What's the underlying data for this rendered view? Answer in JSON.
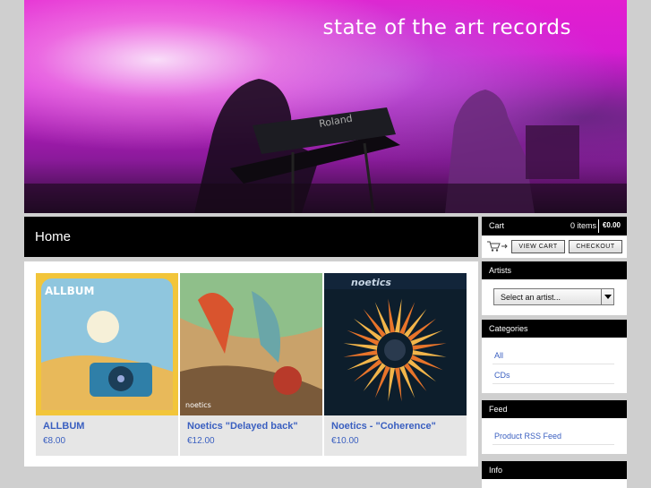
{
  "banner": {
    "title": "state of the art records"
  },
  "page": {
    "heading": "Home"
  },
  "products": [
    {
      "name": "ALLBUM",
      "price": "€8.00",
      "art_text": "ALLBUM"
    },
    {
      "name": "Noetics \"Delayed back\"",
      "price": "€12.00",
      "art_text": "noetics"
    },
    {
      "name": "Noetics - \"Coherence\"",
      "price": "€10.00",
      "art_text": "noetics"
    }
  ],
  "cart": {
    "label": "Cart",
    "items": "0 items",
    "total": "€0.00",
    "view_label": "VIEW CART",
    "checkout_label": "CHECKOUT"
  },
  "artists": {
    "label": "Artists",
    "select_value": "Select an artist..."
  },
  "categories": {
    "label": "Categories",
    "items": [
      "All",
      "CDs"
    ]
  },
  "feed": {
    "label": "Feed",
    "link": "Product RSS Feed"
  },
  "info": {
    "label": "Info"
  }
}
